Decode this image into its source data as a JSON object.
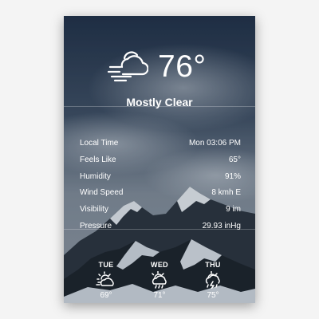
{
  "current": {
    "temperature": "76°",
    "condition": "Mostly Clear",
    "icon": "partly-cloudy-windy-icon"
  },
  "details": [
    {
      "label": "Local Time",
      "value": "Mon 03:06 PM"
    },
    {
      "label": "Feels Like",
      "value": "65°"
    },
    {
      "label": "Humidity",
      "value": "91%"
    },
    {
      "label": "Wind Speed",
      "value": "8 kmh E"
    },
    {
      "label": "Visibility",
      "value": "9 im"
    },
    {
      "label": "Pressure",
      "value": "29.93 inHg"
    }
  ],
  "forecast": [
    {
      "day": "TUE",
      "temp": "69°",
      "icon": "sun-cloud-icon"
    },
    {
      "day": "WED",
      "temp": "71°",
      "icon": "sun-cloud-rain-icon"
    },
    {
      "day": "THU",
      "temp": "75°",
      "icon": "storm-cloud-icon"
    }
  ],
  "colors": {
    "text": "#ffffff",
    "sky_dark": "#1f2f46",
    "sky_light": "#7f8a97",
    "mountain_rock": "#1b2129",
    "snow": "#dfe4ea"
  }
}
